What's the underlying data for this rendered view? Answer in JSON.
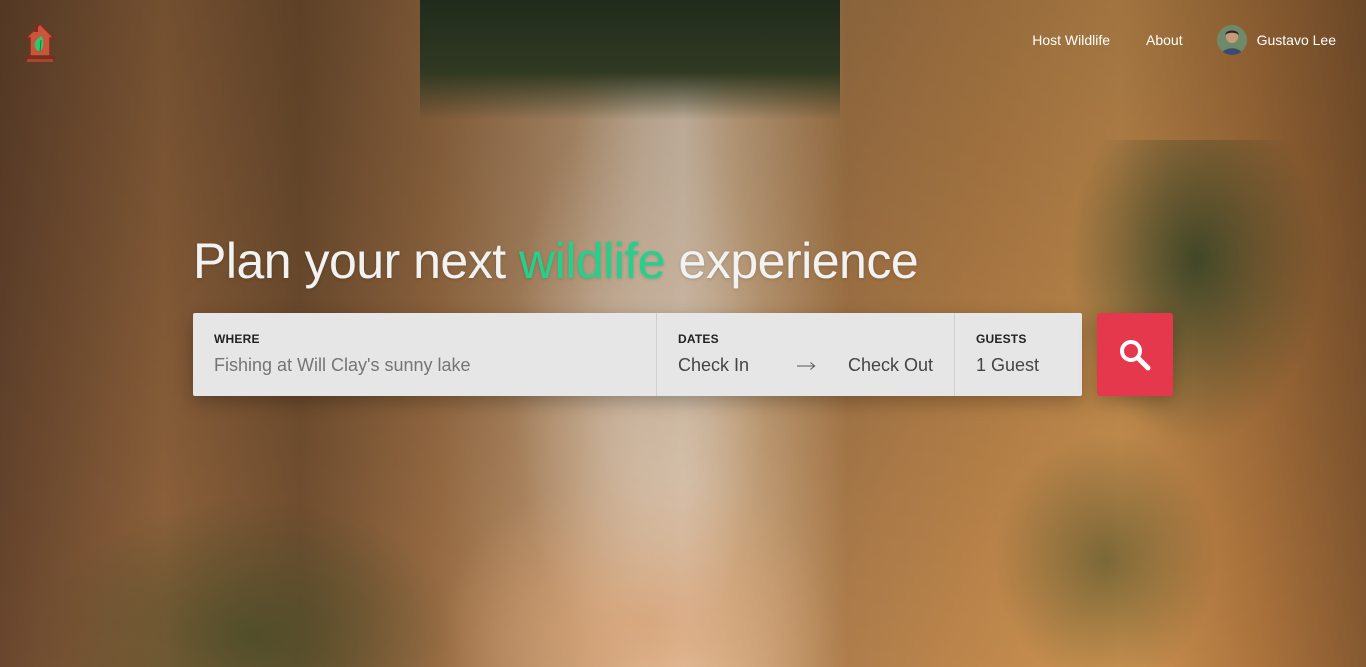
{
  "nav": {
    "host_label": "Host Wildlife",
    "about_label": "About",
    "user_name": "Gustavo Lee"
  },
  "headline": {
    "before": "Plan your next",
    "accent": "wildlife",
    "after": "experience"
  },
  "search": {
    "where_label": "WHERE",
    "where_placeholder": "Fishing at Will Clay's sunny lake",
    "dates_label": "DATES",
    "check_in": "Check In",
    "check_out": "Check Out",
    "guests_label": "GUESTS",
    "guests_value": "1 Guest"
  },
  "icons": {
    "logo": "house-leaf-icon",
    "arrow": "arrow-right-icon",
    "search": "search-icon"
  },
  "colors": {
    "accent": "#22d18b",
    "search_button": "#e6384d"
  }
}
